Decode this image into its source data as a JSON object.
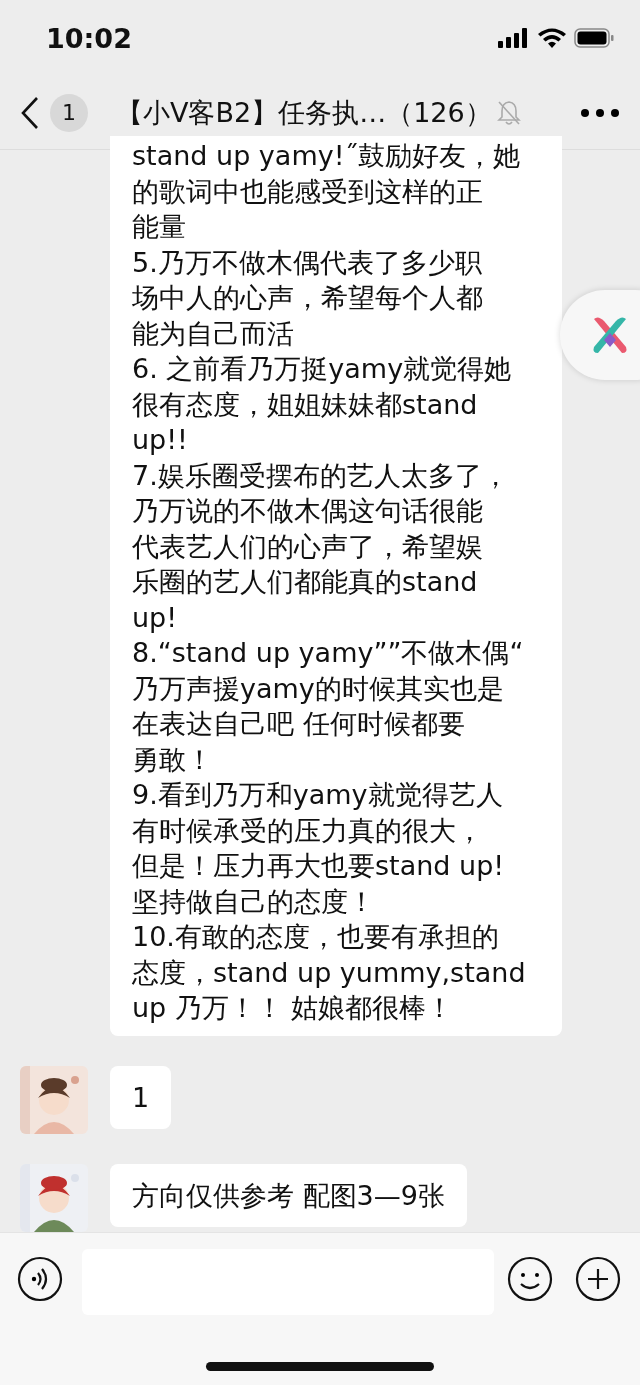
{
  "status_bar": {
    "time": "10:02"
  },
  "nav": {
    "unread": "1",
    "title": "【小V客B2】任务执…（126）",
    "muted": true
  },
  "messages": [
    {
      "avatar": false,
      "paragraphs": [
        {
          "lines": [
            "stand up yamy!˝鼓励好友，她",
            "的歌词中也能感受到这样的正",
            "能量"
          ]
        },
        {
          "lines": [
            "5.乃万不做木偶代表了多少职",
            "场中人的心声，希望每个人都",
            "能为自己而活"
          ]
        },
        {
          "lines": [
            "6. 之前看乃万挺yamy就觉得她",
            "很有态度，姐姐妹妹都stand",
            "up!!"
          ]
        },
        {
          "lines": [
            "7.娱乐圈受摆布的艺人太多了，",
            "乃万说的不做木偶这句话很能",
            "代表艺人们的心声了，希望娱",
            "乐圈的艺人们都能真的stand",
            "up!"
          ]
        },
        {
          "lines": [
            "8.“stand up yamy””不做木偶“",
            "乃万声援yamy的时候其实也是",
            "在表达自己吧  任何时候都要",
            "勇敢！"
          ]
        },
        {
          "lines": [
            "9.看到乃万和yamy就觉得艺人",
            "有时候承受的压力真的很大，",
            "但是！压力再大也要stand up!",
            "坚持做自己的态度！"
          ]
        },
        {
          "lines": [
            "10.有敢的态度，也要有承担的",
            "态度，stand up yummy,stand",
            "up 乃万！！ 姑娘都很棒！"
          ]
        }
      ]
    },
    {
      "paragraphs": [
        {
          "lines": [
            "1"
          ]
        }
      ]
    },
    {
      "paragraphs": [
        {
          "lines": [
            "方向仅供参考  配图3—9张"
          ]
        }
      ]
    }
  ]
}
